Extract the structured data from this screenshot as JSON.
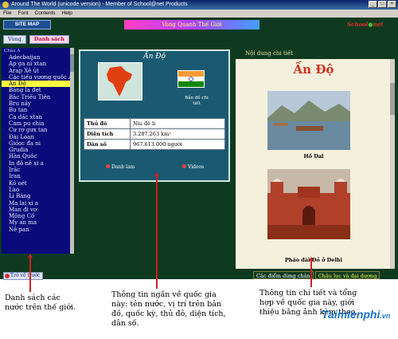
{
  "window": {
    "title": "Around The World (unicode version) - Member of School@net Products"
  },
  "menu": [
    "File",
    "Font",
    "Contents",
    "Help"
  ],
  "toolbar": {
    "sitemap_label": "SITE MAP",
    "banner_text": "Vòng Quanh Thế Giới",
    "brand_school": "School",
    "brand_net": "net"
  },
  "left_panel": {
    "tabs": [
      "Vùng",
      "Danh sách"
    ],
    "list_header": "Châu Á",
    "countries": [
      "Adecbaijan",
      "Ap ga ni xtan",
      "Arap Xê út",
      "Các tiểu vương quốc Ar",
      "Ấn Độ",
      "Băng la đet",
      "Bắc Triều Tiên",
      "Bru nây",
      "Bu tan",
      "Ca dắc xtan",
      "Cam pu chia",
      "Cư rơ gưx tan",
      "Đài Loan",
      "Gióoc đa ni",
      "Grudia",
      "Hàn Quốc",
      "In đô nê xi a",
      "Irắc",
      "Iran",
      "Kô oét",
      "Lào",
      "Li Băng",
      "Ma lai xi a",
      "Man đi vơ",
      "Mông Cổ",
      "My an ma",
      "Nê pan"
    ],
    "selected_country": "Ấn Độ",
    "back_label": "Trở về trước"
  },
  "center_panel": {
    "title": "Ấn Độ",
    "flag_caption": "Bản đồ chi tiết",
    "rows": [
      {
        "key": "Thủ đô",
        "value": "Niu đê li"
      },
      {
        "key": "Diện tích",
        "value": "3.287.263 km²"
      },
      {
        "key": "Dân số",
        "value": "967.613.000  người"
      }
    ],
    "link_list": "Danh lam",
    "link_video": "Videos"
  },
  "right_panel": {
    "header": "Nội dung chi tiết",
    "title": "Ấn Độ",
    "photo1_caption": "Hồ Dal",
    "photo2_caption": "Pháo đài Đỏ ở Delhi"
  },
  "bottom_tabs": [
    "Các điểm dừng chân",
    "Châu lục và đại dương"
  ],
  "annotations": {
    "left": "Danh sách các nước trên thế giới.",
    "center": "Thông tin ngắn về quốc gia này: tên nước, vị trí trên bản đồ, quốc kỳ, thủ đô, diện tích, dân số.",
    "right": "Thông tin chi tiết và tổng hợp về quốc gia này, giới thiệu bằng ảnh kèm theo."
  },
  "watermark": {
    "main": "Taimienphi",
    "suffix": ".vn"
  },
  "colors": {
    "app_bg": "#0e3a1f",
    "list_bg": "#0a0a7a",
    "selected": "#ffff40",
    "accent_red": "#d03020",
    "annotation_arrow": "#d02020"
  }
}
